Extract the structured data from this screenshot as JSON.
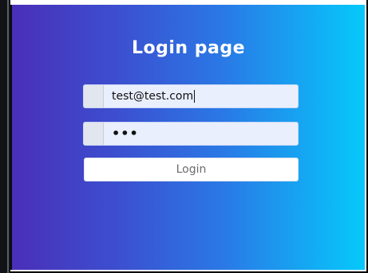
{
  "page": {
    "title": "Login page"
  },
  "form": {
    "email": {
      "value": "test@test.com"
    },
    "password": {
      "value": "•••"
    },
    "login_button": "Login"
  },
  "colors": {
    "gradient_start": "#4a2fb8",
    "gradient_end": "#06c9fb",
    "input_background": "#e9effd"
  }
}
